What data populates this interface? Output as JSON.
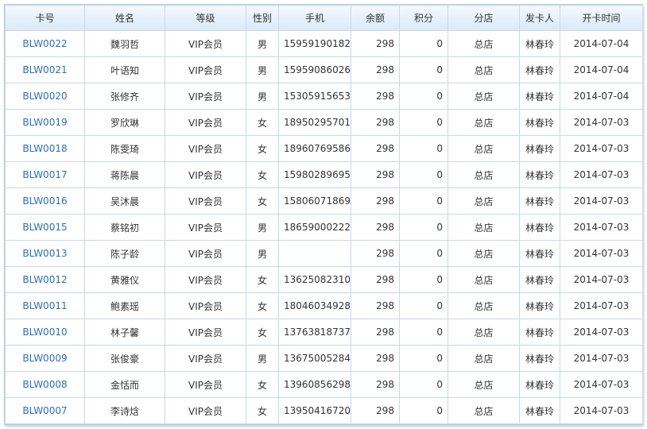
{
  "columns": [
    "卡号",
    "姓名",
    "等级",
    "性别",
    "手机",
    "余额",
    "积分",
    "分店",
    "发卡人",
    "开卡时间"
  ],
  "rows": [
    {
      "card": "BLW0022",
      "name": "魏羽哲",
      "level": "VIP会员",
      "gender": "男",
      "phone": "15959190182",
      "balance": "298",
      "points": "0",
      "branch": "总店",
      "issuer": "林春玲",
      "date": "2014-07-04"
    },
    {
      "card": "BLW0021",
      "name": "叶语知",
      "level": "VIP会员",
      "gender": "男",
      "phone": "15959086026",
      "balance": "298",
      "points": "0",
      "branch": "总店",
      "issuer": "林春玲",
      "date": "2014-07-04"
    },
    {
      "card": "BLW0020",
      "name": "张修齐",
      "level": "VIP会员",
      "gender": "男",
      "phone": "15305915653",
      "balance": "298",
      "points": "0",
      "branch": "总店",
      "issuer": "林春玲",
      "date": "2014-07-04"
    },
    {
      "card": "BLW0019",
      "name": "罗欣琳",
      "level": "VIP会员",
      "gender": "女",
      "phone": "18950295701",
      "balance": "298",
      "points": "0",
      "branch": "总店",
      "issuer": "林春玲",
      "date": "2014-07-03"
    },
    {
      "card": "BLW0018",
      "name": "陈雯琦",
      "level": "VIP会员",
      "gender": "女",
      "phone": "18960769586",
      "balance": "298",
      "points": "0",
      "branch": "总店",
      "issuer": "林春玲",
      "date": "2014-07-03"
    },
    {
      "card": "BLW0017",
      "name": "蒋陈晨",
      "level": "VIP会员",
      "gender": "女",
      "phone": "15980289695",
      "balance": "298",
      "points": "0",
      "branch": "总店",
      "issuer": "林春玲",
      "date": "2014-07-03"
    },
    {
      "card": "BLW0016",
      "name": "吴沐晨",
      "level": "VIP会员",
      "gender": "女",
      "phone": "15806071869",
      "balance": "298",
      "points": "0",
      "branch": "总店",
      "issuer": "林春玲",
      "date": "2014-07-03"
    },
    {
      "card": "BLW0015",
      "name": "蔡铭初",
      "level": "VIP会员",
      "gender": "男",
      "phone": "18659000222",
      "balance": "298",
      "points": "0",
      "branch": "总店",
      "issuer": "林春玲",
      "date": "2014-07-03"
    },
    {
      "card": "BLW0013",
      "name": "陈子龄",
      "level": "VIP会员",
      "gender": "男",
      "phone": "",
      "balance": "298",
      "points": "0",
      "branch": "总店",
      "issuer": "林春玲",
      "date": "2014-07-03"
    },
    {
      "card": "BLW0012",
      "name": "黄雅仪",
      "level": "VIP会员",
      "gender": "女",
      "phone": "13625082310",
      "balance": "298",
      "points": "0",
      "branch": "总店",
      "issuer": "林春玲",
      "date": "2014-07-03"
    },
    {
      "card": "BLW0011",
      "name": "鲍素瑶",
      "level": "VIP会员",
      "gender": "女",
      "phone": "18046034928",
      "balance": "298",
      "points": "0",
      "branch": "总店",
      "issuer": "林春玲",
      "date": "2014-07-03"
    },
    {
      "card": "BLW0010",
      "name": "林子馨",
      "level": "VIP会员",
      "gender": "女",
      "phone": "13763818737",
      "balance": "298",
      "points": "0",
      "branch": "总店",
      "issuer": "林春玲",
      "date": "2014-07-03"
    },
    {
      "card": "BLW0009",
      "name": "张俊豪",
      "level": "VIP会员",
      "gender": "男",
      "phone": "13675005284",
      "balance": "298",
      "points": "0",
      "branch": "总店",
      "issuer": "林春玲",
      "date": "2014-07-03"
    },
    {
      "card": "BLW0008",
      "name": "金恬而",
      "level": "VIP会员",
      "gender": "女",
      "phone": "13960856298",
      "balance": "298",
      "points": "0",
      "branch": "总店",
      "issuer": "林春玲",
      "date": "2014-07-03"
    },
    {
      "card": "BLW0007",
      "name": "李诗焓",
      "level": "VIP会员",
      "gender": "女",
      "phone": "13950416720",
      "balance": "298",
      "points": "0",
      "branch": "总店",
      "issuer": "林春玲",
      "date": "2014-07-03"
    }
  ],
  "colors": {
    "link": "#2a6ebd",
    "header_gradient_top": "#f4f9fe",
    "header_gradient_bottom": "#d9e9f8",
    "grid_line": "#c8d8ea"
  }
}
